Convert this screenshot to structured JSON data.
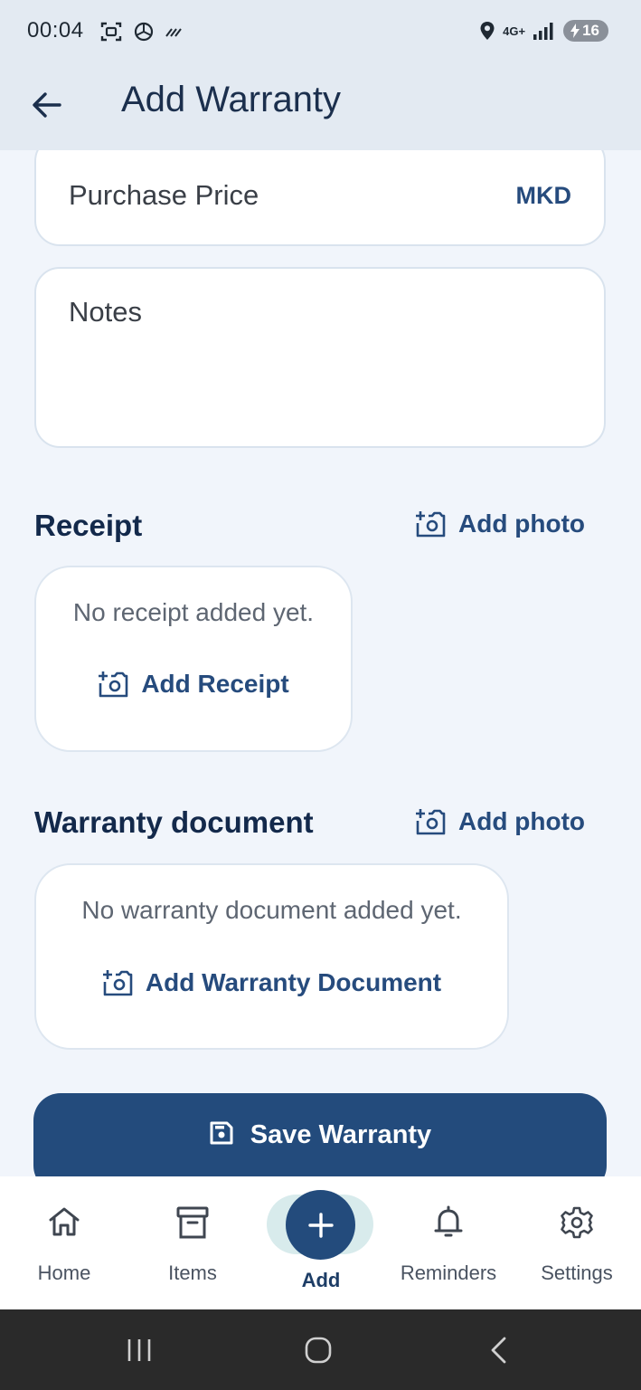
{
  "status_bar": {
    "time": "00:04",
    "network": "4G+",
    "battery": "16"
  },
  "app_bar": {
    "title": "Add Warranty"
  },
  "form": {
    "purchase_price_label": "Purchase Price",
    "currency": "MKD",
    "notes_label": "Notes"
  },
  "receipt": {
    "title": "Receipt",
    "add_photo": "Add photo",
    "empty_text": "No receipt added yet.",
    "add_button": "Add Receipt"
  },
  "warranty_document": {
    "title": "Warranty document",
    "add_photo": "Add photo",
    "empty_text": "No warranty document added yet.",
    "add_button": "Add Warranty Document"
  },
  "save_button": "Save Warranty",
  "bottom_nav": {
    "home": "Home",
    "items": "Items",
    "add": "Add",
    "reminders": "Reminders",
    "settings": "Settings"
  },
  "colors": {
    "primary": "#234b7c",
    "background": "#f1f5fb",
    "topbar": "#e3eaf2",
    "add_pill": "#d8ebec"
  }
}
